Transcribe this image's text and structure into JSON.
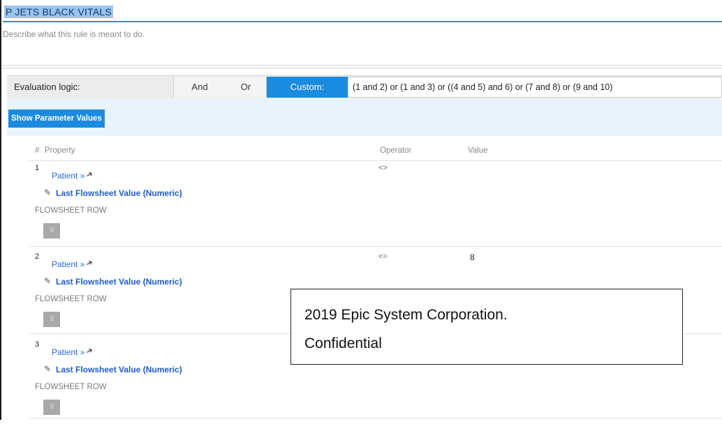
{
  "rule": {
    "name": "P JETS BLACK VITALS",
    "description_placeholder": "Describe what this rule is meant to do."
  },
  "evaluation": {
    "label": "Evaluation logic:",
    "options": [
      "And",
      "Or",
      "Custom:"
    ],
    "selected": "Custom:",
    "custom_expression": "(1 and 2) or (1 and 3) or ((4 and 5) and 6) or (7 and 8) or (9 and 10)"
  },
  "parameters": {
    "show_button_label": "Show Parameter Values"
  },
  "table": {
    "headers": {
      "num": "#",
      "property": "Property",
      "operator": "Operator",
      "value": "Value"
    },
    "rows": [
      {
        "num": "1",
        "entity": "Patient »",
        "property": "Last Flowsheet Value (Numeric)",
        "row_label": "FLOWSHEET ROW",
        "row_value": "9",
        "operator": "<>",
        "value": ""
      },
      {
        "num": "2",
        "entity": "Patient »",
        "property": "Last Flowsheet Value (Numeric)",
        "row_label": "FLOWSHEET ROW",
        "row_value": "9",
        "operator": "<=",
        "value": "8"
      },
      {
        "num": "3",
        "entity": "Patient »",
        "property": "Last Flowsheet Value (Numeric)",
        "row_label": "FLOWSHEET ROW",
        "row_value": "9",
        "operator": "",
        "value": ""
      }
    ]
  },
  "watermark": {
    "line1": "2019 Epic System Corporation.",
    "line2": "Confidential"
  },
  "colors": {
    "accent_blue": "#1b8bdf",
    "link_blue": "#2a6ad6",
    "title_highlight": "#9cc4ec",
    "param_band": "#e8f3fc"
  },
  "icons": {
    "entity_link": "link-arrow-icon",
    "property_edit": "pencil-icon"
  }
}
